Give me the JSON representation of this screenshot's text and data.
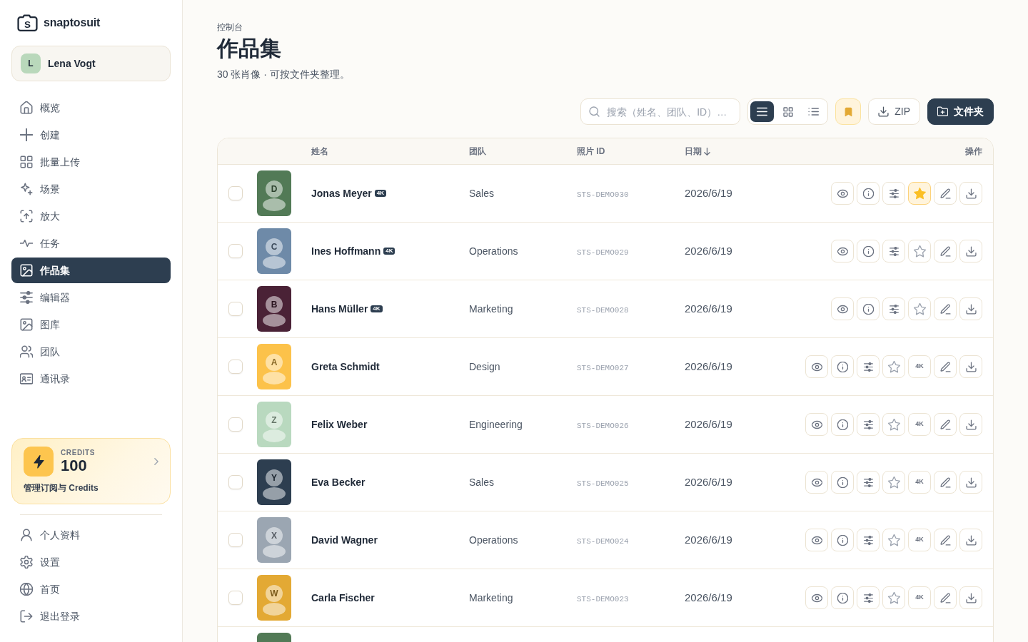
{
  "sidebar": {
    "logo": {
      "mark": "S",
      "name": "snaptosuit"
    },
    "user": {
      "initial": "L",
      "name": "Lena Vogt"
    },
    "nav": [
      {
        "kind": "home",
        "label": "概览",
        "selected": false
      },
      {
        "kind": "create",
        "label": "创建",
        "selected": false
      },
      {
        "kind": "batch",
        "label": "批量上传",
        "selected": false
      },
      {
        "kind": "scenes",
        "label": "场景",
        "selected": false
      },
      {
        "kind": "upscale",
        "label": "放大",
        "selected": false
      },
      {
        "kind": "jobs",
        "label": "任务",
        "selected": false
      },
      {
        "kind": "portfolio",
        "label": "作品集",
        "selected": true
      },
      {
        "kind": "editor",
        "label": "编辑器",
        "selected": false
      },
      {
        "kind": "library",
        "label": "图库",
        "selected": false
      },
      {
        "kind": "team",
        "label": "团队",
        "selected": false
      },
      {
        "kind": "contacts",
        "label": "通讯录",
        "selected": false
      }
    ],
    "credits": {
      "label": "CREDITS",
      "amount": "100",
      "link": "管理订阅与 Credits"
    },
    "footer_nav": [
      {
        "kind": "profile",
        "label": "个人资料"
      },
      {
        "kind": "settings",
        "label": "设置"
      },
      {
        "kind": "homepage",
        "label": "首页"
      },
      {
        "kind": "logout",
        "label": "退出登录"
      }
    ]
  },
  "header": {
    "breadcrumb": "控制台",
    "title": "作品集",
    "subtitle": "30 张肖像 · 可按文件夹整理。"
  },
  "toolbar": {
    "search": {
      "placeholder": "搜索（姓名、团队、ID）…"
    },
    "view_modes": [
      {
        "kind": "list",
        "selected": true
      },
      {
        "kind": "grid",
        "selected": false
      },
      {
        "kind": "compact",
        "selected": false
      }
    ],
    "bookmark_filter": {
      "on": true
    },
    "buttons": [
      {
        "kind": "download",
        "label": "ZIP"
      },
      {
        "kind": "folder",
        "label": "文件夹"
      }
    ]
  },
  "table": {
    "columns": [
      {
        "label": "姓名"
      },
      {
        "label": "团队"
      },
      {
        "label": "照片 ID"
      },
      {
        "label": "日期",
        "sort_descending": true
      },
      {
        "label": "操作"
      }
    ],
    "rows": [
      {
        "checked": false,
        "color": "#527a56",
        "initial": "D",
        "name": "Jonas Meyer",
        "badge": "4K",
        "team": "Sales",
        "photo_id": "STS-DEMO030",
        "date": "2026/6/19",
        "favorite": true
      },
      {
        "checked": false,
        "color": "#6e8aa8",
        "initial": "C",
        "name": "Ines Hoffmann",
        "badge": "4K",
        "team": "Operations",
        "photo_id": "STS-DEMO029",
        "date": "2026/6/19",
        "favorite": false
      },
      {
        "checked": false,
        "color": "#4a2236",
        "initial": "B",
        "name": "Hans Müller",
        "badge": "4K",
        "team": "Marketing",
        "photo_id": "STS-DEMO028",
        "date": "2026/6/19",
        "favorite": false
      },
      {
        "checked": false,
        "color": "#fcc24a",
        "initial": "A",
        "name": "Greta Schmidt",
        "team": "Design",
        "photo_id": "STS-DEMO027",
        "date": "2026/6/19",
        "favorite": false,
        "upscale": "4K"
      },
      {
        "checked": false,
        "color": "#b9d9bf",
        "initial": "Z",
        "name": "Felix Weber",
        "team": "Engineering",
        "photo_id": "STS-DEMO026",
        "date": "2026/6/19",
        "favorite": false,
        "upscale": "4K"
      },
      {
        "checked": false,
        "color": "#2d3e50",
        "initial": "Y",
        "name": "Eva Becker",
        "team": "Sales",
        "photo_id": "STS-DEMO025",
        "date": "2026/6/19",
        "favorite": false,
        "upscale": "4K"
      },
      {
        "checked": false,
        "color": "#9ba6b2",
        "initial": "X",
        "name": "David Wagner",
        "team": "Operations",
        "photo_id": "STS-DEMO024",
        "date": "2026/6/19",
        "favorite": false,
        "upscale": "4K"
      },
      {
        "checked": false,
        "color": "#e3a934",
        "initial": "W",
        "name": "Carla Fischer",
        "team": "Marketing",
        "photo_id": "STS-DEMO023",
        "date": "2026/6/19",
        "favorite": false,
        "upscale": "4K"
      },
      {
        "color": "#527a56"
      }
    ]
  }
}
